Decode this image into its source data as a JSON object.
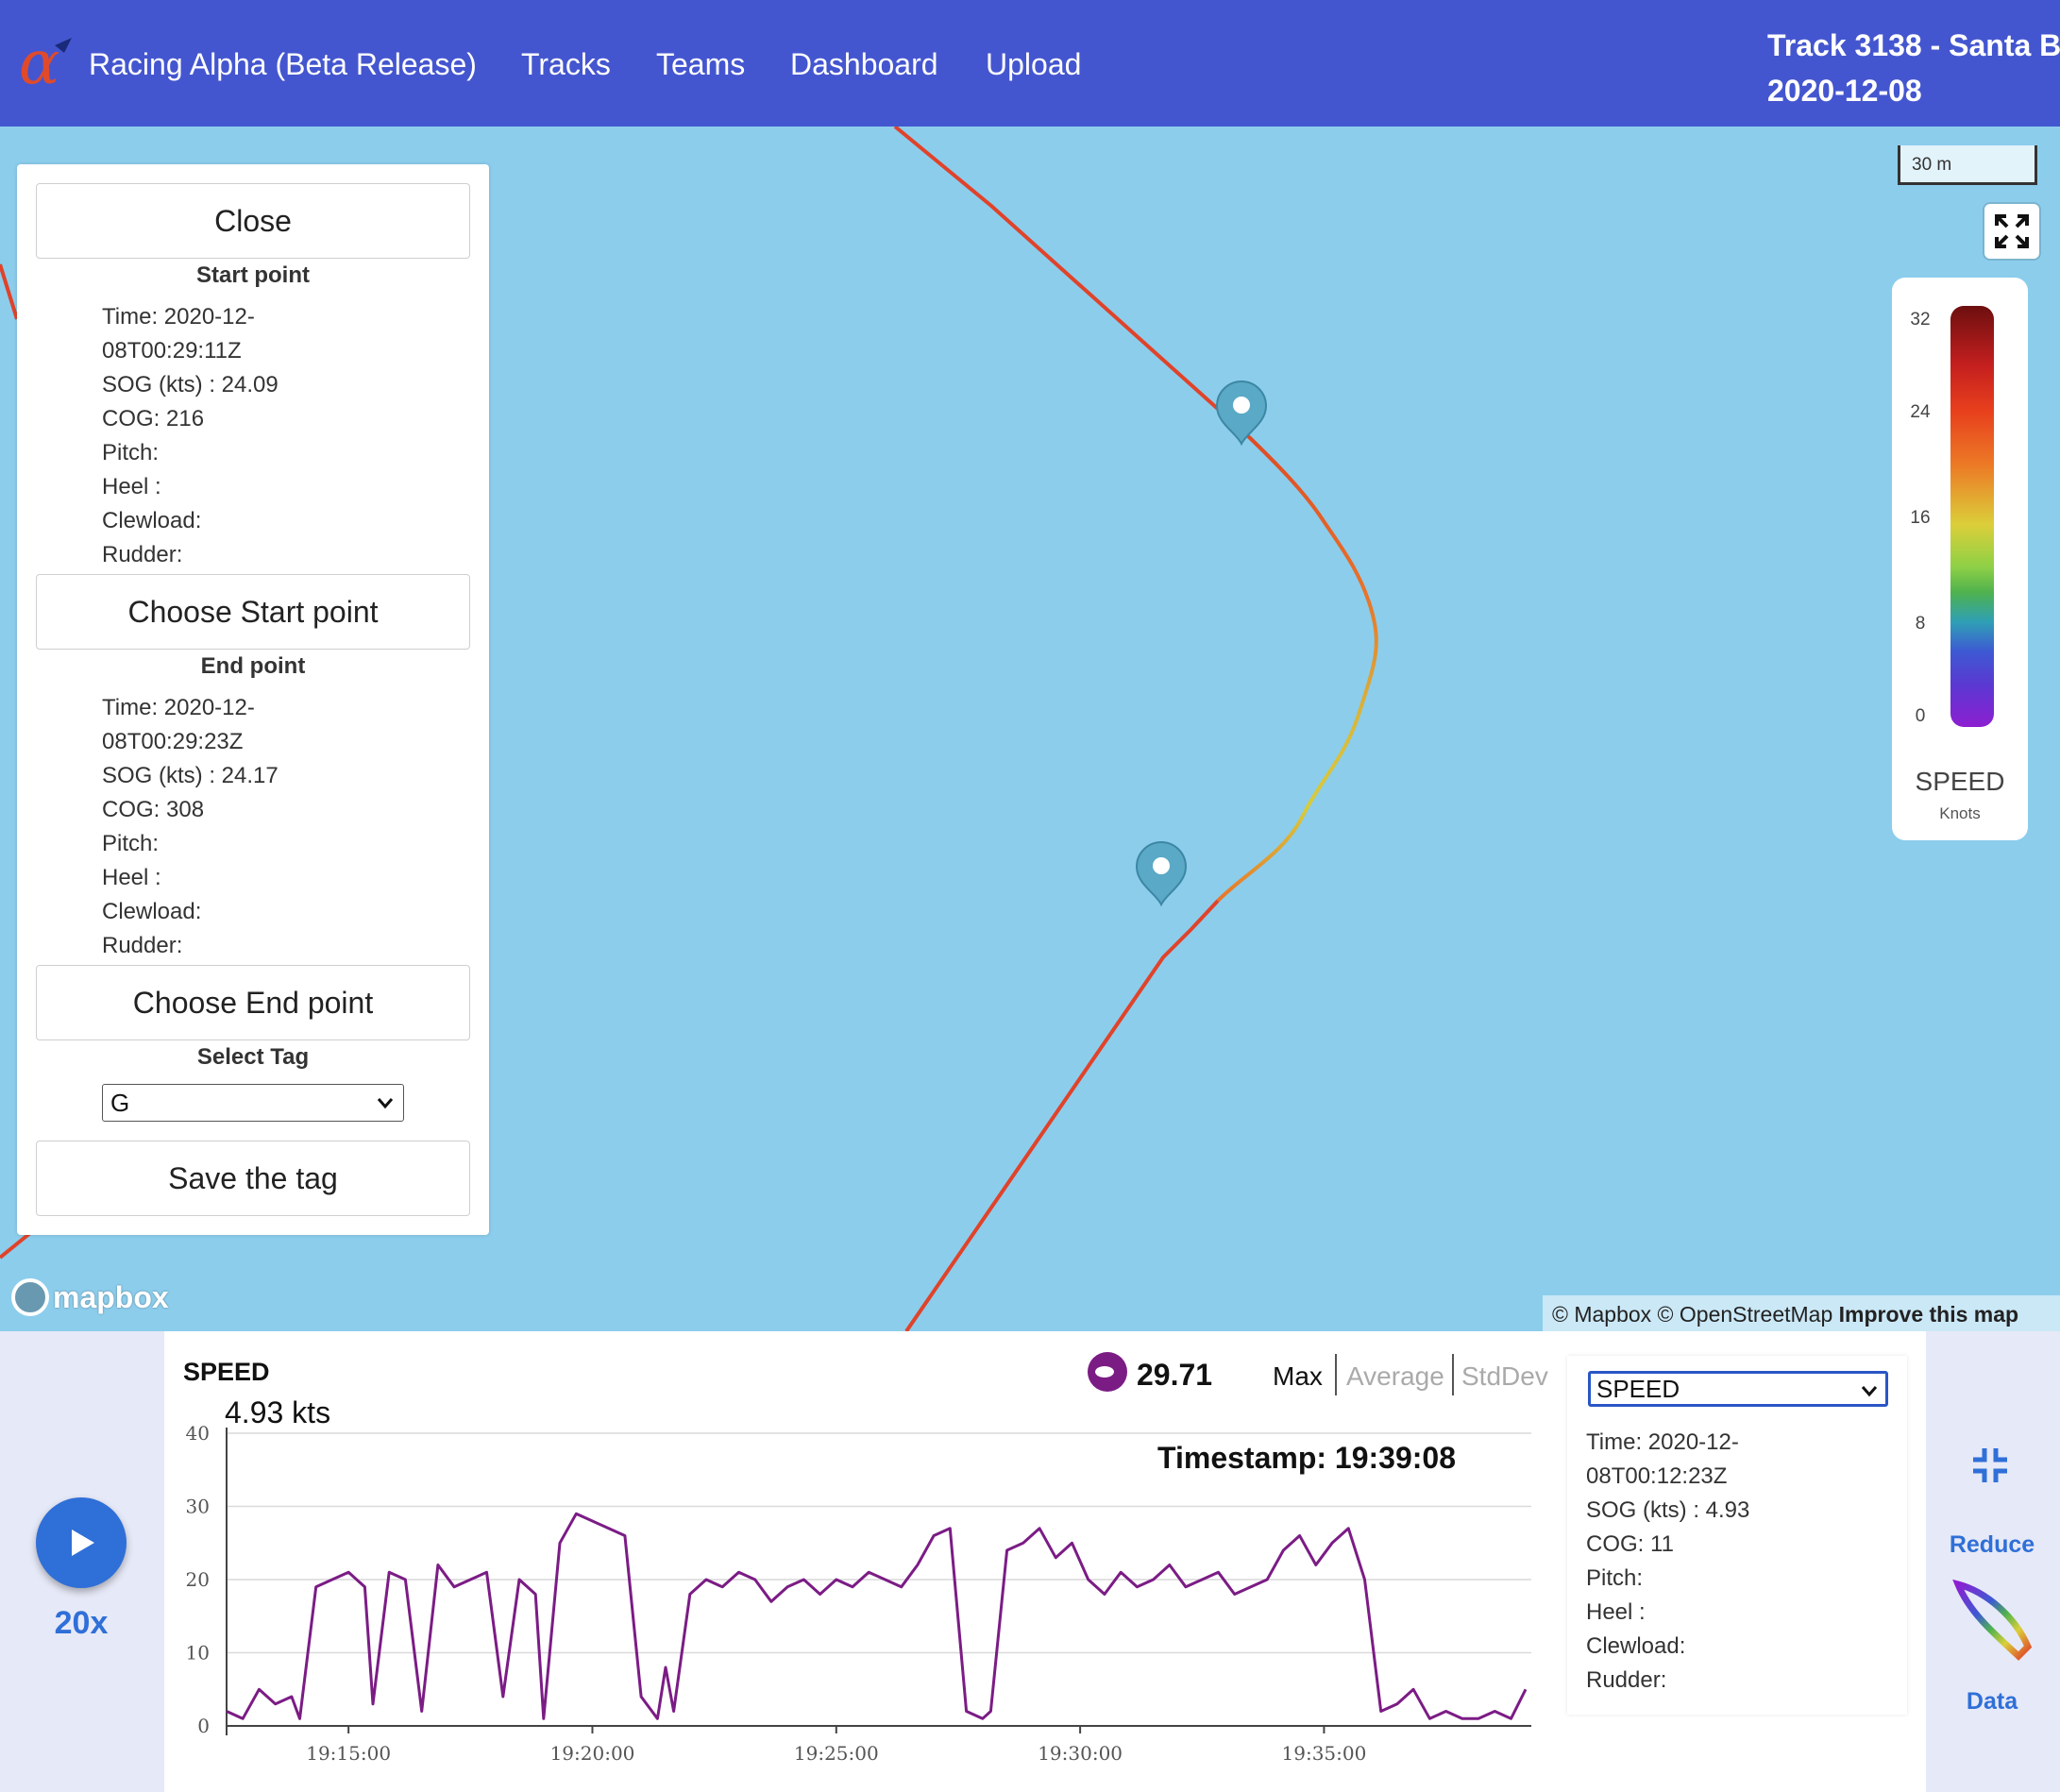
{
  "navbar": {
    "brand": "Racing Alpha (Beta Release)",
    "links": [
      "Tracks",
      "Teams",
      "Dashboard",
      "Upload"
    ],
    "track_title_line1": "Track 3138 - Santa B",
    "track_title_line2": "2020-12-08",
    "bg_color": "#4456cf"
  },
  "panel": {
    "close_label": "Close",
    "start_title": "Start point",
    "start_info": {
      "time1": "Time: 2020-12-",
      "time2": "08T00:29:11Z",
      "sog": "SOG (kts) : 24.09",
      "cog": "COG: 216",
      "pitch": "Pitch:",
      "heel": "Heel :",
      "clewload": "Clewload:",
      "rudder": "Rudder:"
    },
    "choose_start_label": "Choose Start point",
    "end_title": "End point",
    "end_info": {
      "time1": "Time: 2020-12-",
      "time2": "08T00:29:23Z",
      "sog": "SOG (kts) : 24.17",
      "cog": "COG: 308",
      "pitch": "Pitch:",
      "heel": "Heel :",
      "clewload": "Clewload:",
      "rudder": "Rudder:"
    },
    "choose_end_label": "Choose End point",
    "tag_title": "Select Tag",
    "tag_value": "G",
    "save_tag_label": "Save the tag"
  },
  "map": {
    "scale_label": "30 m",
    "water_color": "#8ccdec",
    "attribution_1": "© Mapbox © OpenStreetMap",
    "attribution_2": "Improve this map",
    "mapbox_logo": "mapbox",
    "icons": [
      "fullscreen-icon",
      "map-marker-icon"
    ]
  },
  "legend": {
    "ticks": [
      "32",
      "24",
      "16",
      "8",
      "0"
    ],
    "title": "SPEED",
    "unit": "Knots"
  },
  "playback": {
    "speed_multiplier": "20x",
    "icon": "play-icon"
  },
  "chart_panel": {
    "label": "SPEED",
    "current_value": "4.93 kts",
    "max_value": "29.71",
    "stat_tabs": [
      "Max",
      "Average",
      "StdDev"
    ],
    "active_stat": "Max",
    "timestamp": "Timestamp: 19:39:08"
  },
  "chart_data": {
    "type": "line",
    "title": "",
    "xlabel": "",
    "ylabel": "",
    "ylim": [
      0,
      40
    ],
    "yticks": [
      "0",
      "10",
      "20",
      "30",
      "40"
    ],
    "xticks": [
      "19:15:00",
      "19:20:00",
      "19:25:00",
      "19:30:00",
      "19:35:00"
    ],
    "xlim": [
      "19:12:30",
      "19:39:15"
    ],
    "line_color": "#7b1c85",
    "series": [
      {
        "name": "",
        "x": [
          "19:12:30",
          "19:12:50",
          "19:13:10",
          "19:13:30",
          "19:13:50",
          "19:14:00",
          "19:14:20",
          "19:14:40",
          "19:15:00",
          "19:15:20",
          "19:15:30",
          "19:15:50",
          "19:16:10",
          "19:16:30",
          "19:16:50",
          "19:17:10",
          "19:17:30",
          "19:17:50",
          "19:18:10",
          "19:18:30",
          "19:18:50",
          "19:19:00",
          "19:19:20",
          "19:19:40",
          "19:20:00",
          "19:20:20",
          "19:20:40",
          "19:21:00",
          "19:21:20",
          "19:21:30",
          "19:21:40",
          "19:22:00",
          "19:22:20",
          "19:22:40",
          "19:23:00",
          "19:23:20",
          "19:23:40",
          "19:24:00",
          "19:24:20",
          "19:24:40",
          "19:25:00",
          "19:25:20",
          "19:25:40",
          "19:26:00",
          "19:26:20",
          "19:26:40",
          "19:27:00",
          "19:27:20",
          "19:27:40",
          "19:28:00",
          "19:28:10",
          "19:28:30",
          "19:28:50",
          "19:29:10",
          "19:29:30",
          "19:29:50",
          "19:30:10",
          "19:30:30",
          "19:30:50",
          "19:31:10",
          "19:31:30",
          "19:31:50",
          "19:32:10",
          "19:32:30",
          "19:32:50",
          "19:33:10",
          "19:33:30",
          "19:33:50",
          "19:34:10",
          "19:34:30",
          "19:34:50",
          "19:35:10",
          "19:35:30",
          "19:35:50",
          "19:36:10",
          "19:36:30",
          "19:36:50",
          "19:37:10",
          "19:37:30",
          "19:37:50",
          "19:38:10",
          "19:38:30",
          "19:38:50",
          "19:39:08"
        ],
        "values": [
          2,
          1,
          5,
          3,
          4,
          1,
          19,
          20,
          21,
          19,
          3,
          21,
          20,
          2,
          22,
          19,
          20,
          21,
          4,
          20,
          18,
          1,
          25,
          29,
          28,
          27,
          26,
          4,
          1,
          8,
          2,
          18,
          20,
          19,
          21,
          20,
          17,
          19,
          20,
          18,
          20,
          19,
          21,
          20,
          19,
          22,
          26,
          27,
          2,
          1,
          2,
          24,
          25,
          27,
          23,
          25,
          20,
          18,
          21,
          19,
          20,
          22,
          19,
          20,
          21,
          18,
          19,
          20,
          24,
          26,
          22,
          25,
          27,
          20,
          2,
          3,
          5,
          1,
          2,
          1,
          1,
          2,
          1,
          5
        ]
      }
    ]
  },
  "side_info": {
    "metric_select": "SPEED",
    "time1": "Time: 2020-12-",
    "time2": "08T00:12:23Z",
    "sog": "SOG (kts) : 4.93",
    "cog": "COG: 11",
    "pitch": "Pitch:",
    "heel": "Heel :",
    "clewload": "Clewload:",
    "rudder": "Rudder:"
  },
  "right_tools": {
    "reduce_label": "Reduce",
    "data_label": "Data",
    "icons": [
      "reduce-icon",
      "data-icon"
    ]
  }
}
